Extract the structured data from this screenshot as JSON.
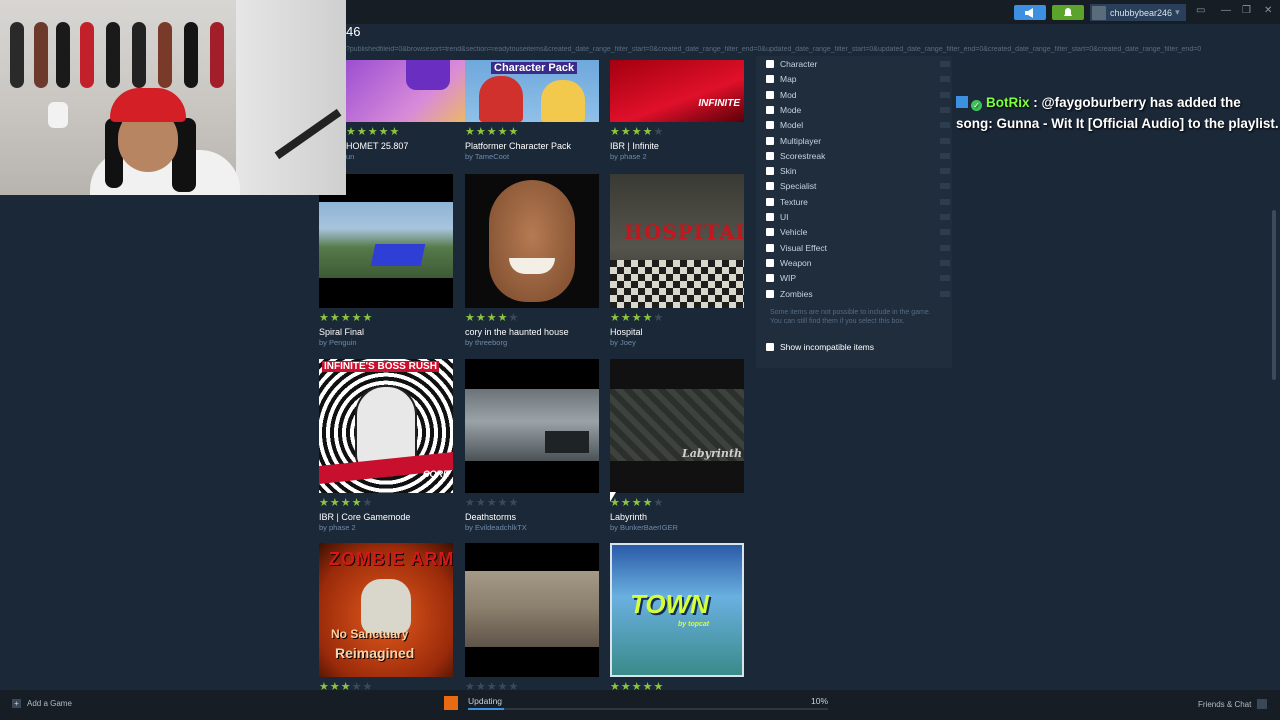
{
  "topbar": {
    "user_name": "chubbybear246",
    "user_caret": "▾",
    "window_controls": [
      "▭",
      "—",
      "❐",
      "✕"
    ]
  },
  "page": {
    "title": "46",
    "url": "?publishedfileid=0&browsesort=trend&section=readytouseitems&created_date_range_filter_start=0&created_date_range_filter_end=0&updated_date_range_filter_start=0&updated_date_range_filter_end=0&created_date_range_filter_start=0&created_date_range_filter_end=0"
  },
  "workshop_items": [
    {
      "title": "HOMET 25.807",
      "author": "un",
      "rating": 5,
      "thumb_label": ""
    },
    {
      "title": "Platformer Character Pack",
      "author": "by TameCoot",
      "rating": 5,
      "thumb_label": "Character Pack"
    },
    {
      "title": "IBR | Infinite",
      "author": "by phase 2",
      "rating": 4,
      "thumb_label": "INFINITE"
    },
    {
      "title": "Spiral Final",
      "author": "by Penguin",
      "rating": 5,
      "thumb_label": ""
    },
    {
      "title": "cory in the haunted house",
      "author": "by threeborg",
      "rating": 4,
      "thumb_label": ""
    },
    {
      "title": "Hospital",
      "author": "by Joey",
      "rating": 4,
      "thumb_label": "HOSPITAL"
    },
    {
      "title": "IBR | Core Gamemode",
      "author": "by phase 2",
      "rating": 4,
      "thumb_label": "INFINITE'S BOSS RUSH"
    },
    {
      "title": "Deathstorms",
      "author": "by EvildeadchlkTX",
      "rating": 0,
      "thumb_label": ""
    },
    {
      "title": "Labyrinth",
      "author": "by BunkerBaerIGER",
      "rating": 4,
      "thumb_label": "Labyrinth"
    },
    {
      "title": "",
      "author": "",
      "rating": 3,
      "thumb_label": "ZOMBIE ARMY"
    },
    {
      "title": "",
      "author": "",
      "rating": 0,
      "thumb_label": ""
    },
    {
      "title": "",
      "author": "",
      "rating": 5,
      "thumb_label": "TOWN"
    }
  ],
  "thumb_extra": {
    "core": "CORE",
    "zombie_sub": "No Sanctuary",
    "zombie_sub2": "Reimagined",
    "town_sub": "by topcat"
  },
  "filters": {
    "items": [
      "Character",
      "Map",
      "Mod",
      "Mode",
      "Model",
      "Multiplayer",
      "Scorestreak",
      "Skin",
      "Specialist",
      "Texture",
      "UI",
      "Vehicle",
      "Visual Effect",
      "Weapon",
      "WIP",
      "Zombies"
    ],
    "note": "Some items are not possible to include in the game. You can still find them if you select this box.",
    "show_incompatible": "Show incompatible items"
  },
  "chat": {
    "user": "BotRix",
    "separator": " : ",
    "message": "@faygoburberry has added the song: Gunna - Wit It [Official Audio] to the playlist."
  },
  "bottombar": {
    "add_game": "Add a Game",
    "updating": "Updating",
    "progress": 0.1,
    "percent": "10%",
    "friends": "Friends & Chat"
  },
  "colors": {
    "accent_blue": "#3d8fe0",
    "star_green": "#8cc63f",
    "update_orange": "#e86a13"
  },
  "icons": {
    "announce": "megaphone-icon",
    "notify": "bell-icon",
    "add": "plus-icon",
    "update": "download-icon",
    "friends": "chat-icon"
  }
}
